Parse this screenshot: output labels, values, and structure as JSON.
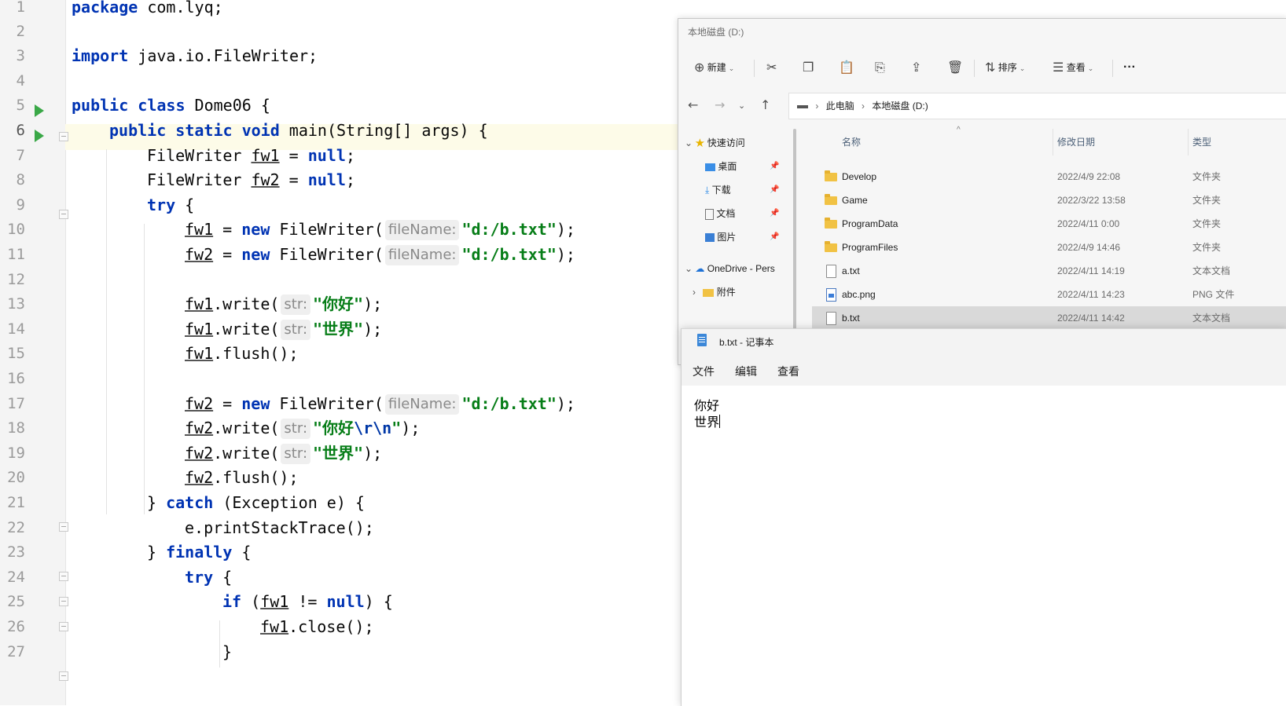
{
  "ide": {
    "line_numbers": [
      "1",
      "2",
      "3",
      "4",
      "5",
      "6",
      "7",
      "8",
      "9",
      "10",
      "11",
      "12",
      "13",
      "14",
      "15",
      "16",
      "17",
      "18",
      "19",
      "20",
      "21",
      "22",
      "23",
      "24",
      "25",
      "26",
      "27"
    ],
    "code": {
      "l1_kw": "package",
      "l1_rest": " com.lyq;",
      "l3_kw": "import",
      "l3_rest": " java.io.FileWriter;",
      "l5_kw": "public class",
      "l5_rest": " Dome06 {",
      "l6_kw": "public static void",
      "l6_rest": " main(String[] args) {",
      "l7_a": "FileWriter ",
      "l7_var": "fw1",
      "l7_b": " = ",
      "l7_kw": "null",
      "l7_c": ";",
      "l8_a": "FileWriter ",
      "l8_var": "fw2",
      "l8_b": " = ",
      "l8_kw": "null",
      "l8_c": ";",
      "l9_kw": "try",
      "l9_rest": " {",
      "l10_var": "fw1",
      "l10_a": " = ",
      "l10_kw": "new",
      "l10_b": " FileWriter(",
      "l10_hint": "fileName:",
      "l10_str": "\"d:/b.txt\"",
      "l10_c": ");",
      "l11_var": "fw2",
      "l11_a": " = ",
      "l11_kw": "new",
      "l11_b": " FileWriter(",
      "l11_hint": "fileName:",
      "l11_str": "\"d:/b.txt\"",
      "l11_c": ");",
      "l13_var": "fw1",
      "l13_a": ".write(",
      "l13_hint": "str:",
      "l13_str": "\"你好\"",
      "l13_c": ");",
      "l14_var": "fw1",
      "l14_a": ".write(",
      "l14_hint": "str:",
      "l14_str": "\"世界\"",
      "l14_c": ");",
      "l15_var": "fw1",
      "l15_a": ".flush();",
      "l17_var": "fw2",
      "l17_a": " = ",
      "l17_kw": "new",
      "l17_b": " FileWriter(",
      "l17_hint": "fileName:",
      "l17_str": "\"d:/b.txt\"",
      "l17_c": ");",
      "l18_var": "fw2",
      "l18_a": ".write(",
      "l18_hint": "str:",
      "l18_str1": "\"你好",
      "l18_esc": "\\r\\n",
      "l18_str2": "\"",
      "l18_c": ");",
      "l19_var": "fw2",
      "l19_a": ".write(",
      "l19_hint": "str:",
      "l19_str": "\"世界\"",
      "l19_c": ");",
      "l20_var": "fw2",
      "l20_a": ".flush();",
      "l21_a": "} ",
      "l21_kw": "catch",
      "l21_b": " (Exception e) {",
      "l22_a": "e.printStackTrace();",
      "l23_a": "} ",
      "l23_kw": "finally",
      "l23_b": " {",
      "l24_kw": "try",
      "l24_b": " {",
      "l25_kw": "if",
      "l25_a": " (",
      "l25_var": "fw1",
      "l25_b": " != ",
      "l25_kw2": "null",
      "l25_c": ") {",
      "l26_var": "fw1",
      "l26_a": ".close();",
      "l27_a": "}"
    }
  },
  "explorer": {
    "title": "本地磁盘 (D:)",
    "toolbar": {
      "new": "新建",
      "sort": "排序",
      "view": "查看",
      "more": "···"
    },
    "breadcrumb": {
      "pc": "此电脑",
      "drive": "本地磁盘 (D:)"
    },
    "sidebar": {
      "quick_access": "快速访问",
      "desktop": "桌面",
      "downloads": "下载",
      "documents": "文档",
      "pictures": "图片",
      "onedrive": "OneDrive - Pers",
      "attachments": "附件"
    },
    "columns": {
      "name": "名称",
      "date": "修改日期",
      "type": "类型"
    },
    "files": [
      {
        "name": "Develop",
        "date": "2022/4/9 22:08",
        "type": "文件夹"
      },
      {
        "name": "Game",
        "date": "2022/3/22 13:58",
        "type": "文件夹"
      },
      {
        "name": "ProgramData",
        "date": "2022/4/11 0:00",
        "type": "文件夹"
      },
      {
        "name": "ProgramFiles",
        "date": "2022/4/9 14:46",
        "type": "文件夹"
      },
      {
        "name": "a.txt",
        "date": "2022/4/11 14:19",
        "type": "文本文档"
      },
      {
        "name": "abc.png",
        "date": "2022/4/11 14:23",
        "type": "PNG 文件"
      },
      {
        "name": "b.txt",
        "date": "2022/4/11 14:42",
        "type": "文本文档"
      }
    ]
  },
  "notepad": {
    "title": "b.txt - 记事本",
    "menu": {
      "file": "文件",
      "edit": "编辑",
      "view": "查看"
    },
    "line1": "你好",
    "line2": "世界"
  }
}
